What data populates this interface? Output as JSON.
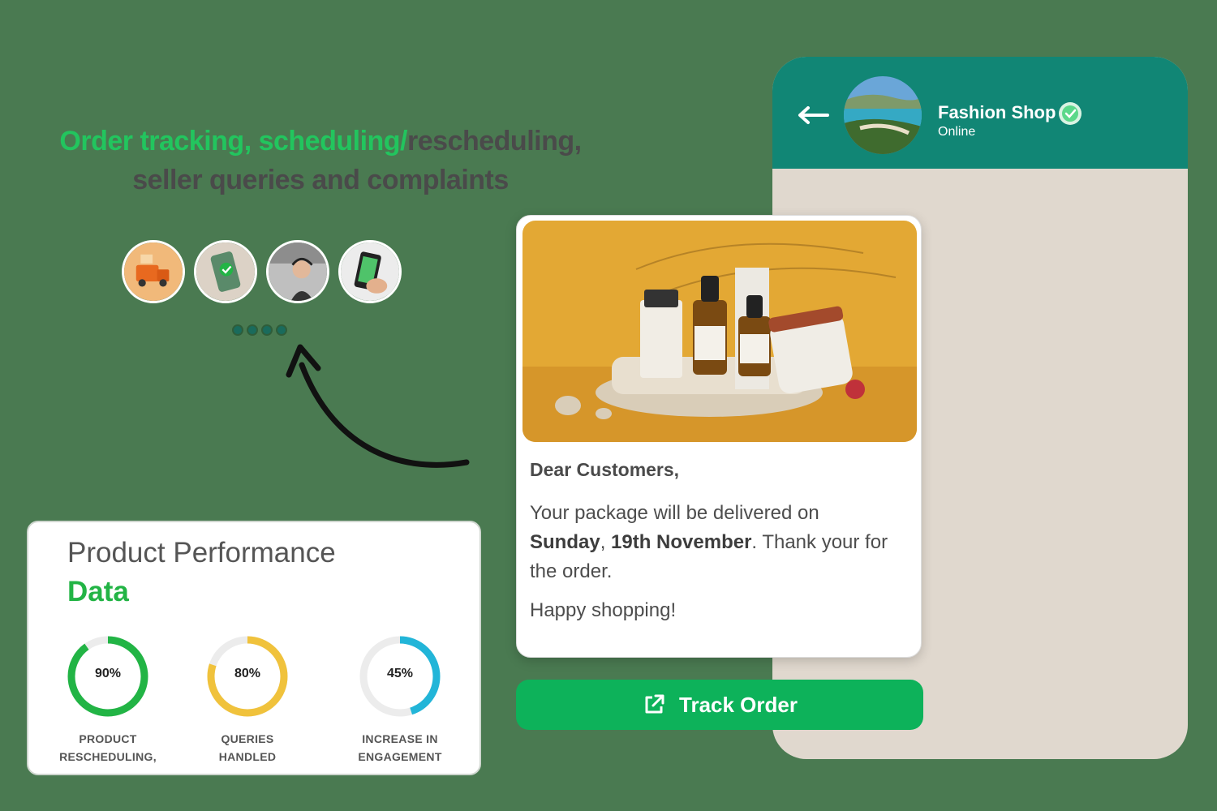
{
  "headline": {
    "line1_green": "Order tracking, scheduling/",
    "line1_gray": "rescheduling,",
    "line2": "seller queries and complaints"
  },
  "carousel": {
    "thumbnails": [
      "delivery-truck-image",
      "phone-check-image",
      "support-agent-image",
      "mobile-app-image"
    ],
    "dot_count": 4
  },
  "chat": {
    "shop_name": "Fashion Shop",
    "status": "Online",
    "message": {
      "greeting": "Dear Customers,",
      "line_prefix": "Your package will be delivered on",
      "day": "Sunday",
      "separator": ", ",
      "date": "19th November",
      "line_suffix": ". Thank your for the order.",
      "closing": "Happy shopping!"
    },
    "button_label": "Track Order"
  },
  "performance": {
    "title": "Product Performance",
    "subtitle": "Data",
    "metrics": [
      {
        "value": "90%",
        "fraction": 0.9,
        "color": "#22b445",
        "label_line1": "PRODUCT",
        "label_line2": "RESCHEDULING,"
      },
      {
        "value": "80%",
        "fraction": 0.8,
        "color": "#f0c23c",
        "label_line1": "QUERIES",
        "label_line2": "HANDLED"
      },
      {
        "value": "45%",
        "fraction": 0.45,
        "color": "#22b5d8",
        "label_line1": "INCREASE IN",
        "label_line2": "ENGAGEMENT"
      }
    ]
  },
  "colors": {
    "accent_green": "#22c55e",
    "header_teal": "#118675",
    "button_green": "#0db25a"
  }
}
